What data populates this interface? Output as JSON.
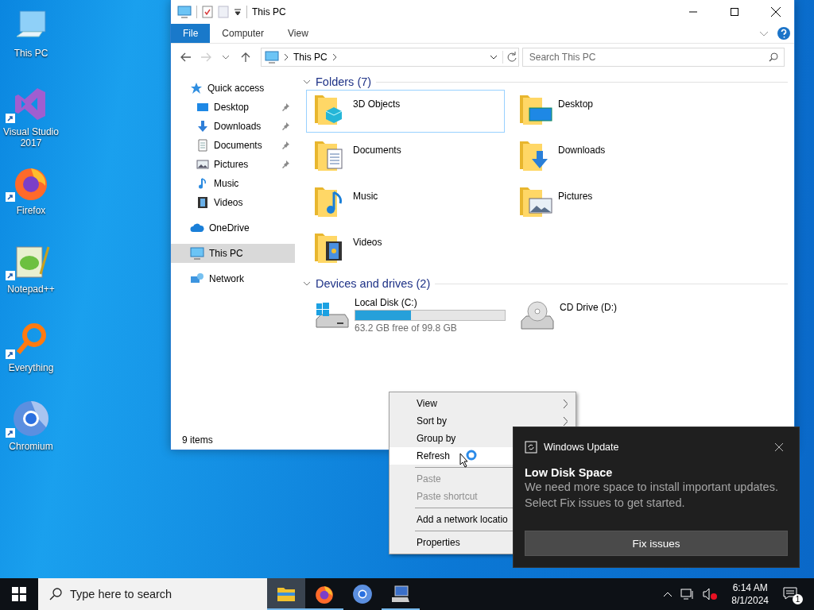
{
  "desktop_icons": [
    {
      "label": "This PC",
      "kind": "pc",
      "shortcut": false
    },
    {
      "label": "Visual Studio 2017",
      "kind": "vs",
      "shortcut": true
    },
    {
      "label": "Firefox",
      "kind": "firefox",
      "shortcut": true
    },
    {
      "label": "Notepad++",
      "kind": "notepad",
      "shortcut": true
    },
    {
      "label": "Everything",
      "kind": "everything",
      "shortcut": true
    },
    {
      "label": "Chromium",
      "kind": "chromium",
      "shortcut": true
    }
  ],
  "explorer": {
    "title": "This PC",
    "ribbon_tabs": [
      {
        "label": "File",
        "selected": true
      },
      {
        "label": "Computer",
        "selected": false
      },
      {
        "label": "View",
        "selected": false
      }
    ],
    "address": {
      "path": "This PC"
    },
    "search": {
      "placeholder": "Search This PC"
    },
    "nav": [
      {
        "label": "Quick access",
        "kind": "star",
        "selected": false,
        "children": [
          {
            "label": "Desktop",
            "kind": "desktop",
            "pinned": true,
            "selected": false
          },
          {
            "label": "Downloads",
            "kind": "downloads",
            "pinned": true,
            "selected": false
          },
          {
            "label": "Documents",
            "kind": "documents",
            "pinned": true,
            "selected": false
          },
          {
            "label": "Pictures",
            "kind": "pictures",
            "pinned": true,
            "selected": false
          },
          {
            "label": "Music",
            "kind": "music",
            "pinned": false,
            "selected": false
          },
          {
            "label": "Videos",
            "kind": "videos",
            "pinned": false,
            "selected": false
          }
        ]
      },
      {
        "label": "OneDrive",
        "kind": "cloud",
        "selected": false
      },
      {
        "label": "This PC",
        "kind": "pc",
        "selected": true
      },
      {
        "label": "Network",
        "kind": "network",
        "selected": false
      }
    ],
    "folders": {
      "heading": "Folders (7)",
      "items": [
        {
          "label": "3D Objects",
          "kind": "objects",
          "selected": true
        },
        {
          "label": "Desktop",
          "kind": "desktop",
          "selected": false
        },
        {
          "label": "Documents",
          "kind": "documents",
          "selected": false
        },
        {
          "label": "Downloads",
          "kind": "downloads",
          "selected": false
        },
        {
          "label": "Music",
          "kind": "music",
          "selected": false
        },
        {
          "label": "Pictures",
          "kind": "pictures",
          "selected": false
        },
        {
          "label": "Videos",
          "kind": "videos",
          "selected": false
        }
      ]
    },
    "drives": {
      "heading": "Devices and drives (2)",
      "items": [
        {
          "label": "Local Disk (C:)",
          "kind": "hdd",
          "level": 0.37,
          "free": "63.2 GB free of 99.8 GB"
        },
        {
          "label": "CD Drive (D:)",
          "kind": "cd"
        }
      ]
    },
    "status_bar": "9 items"
  },
  "context_menu": [
    {
      "kind": "item",
      "label": "View",
      "submenu": true,
      "disabled": false,
      "selected": false
    },
    {
      "kind": "item",
      "label": "Sort by",
      "submenu": true,
      "disabled": false,
      "selected": false
    },
    {
      "kind": "item",
      "label": "Group by",
      "submenu": false,
      "disabled": false,
      "selected": false
    },
    {
      "kind": "item",
      "label": "Refresh",
      "submenu": false,
      "disabled": false,
      "selected": true
    },
    {
      "kind": "separator"
    },
    {
      "kind": "item",
      "label": "Paste",
      "submenu": false,
      "disabled": true,
      "selected": false
    },
    {
      "kind": "item",
      "label": "Paste shortcut",
      "submenu": false,
      "disabled": true,
      "selected": false
    },
    {
      "kind": "separator"
    },
    {
      "kind": "item",
      "label": "Add a network locatio",
      "submenu": false,
      "disabled": false,
      "selected": false
    },
    {
      "kind": "separator"
    },
    {
      "kind": "item",
      "label": "Properties",
      "submenu": false,
      "disabled": false,
      "selected": false
    }
  ],
  "toast": {
    "app": "Windows Update",
    "title": "Low Disk Space",
    "body_lines": [
      "We need more space to install important updates.",
      "Select Fix issues to get started."
    ],
    "button": "Fix issues"
  },
  "taskbar": {
    "search": {
      "placeholder": "Type here to search"
    },
    "apps": [
      {
        "kind": "explorer",
        "running": true,
        "selected": true
      },
      {
        "kind": "firefox",
        "running": true,
        "selected": false
      },
      {
        "kind": "chromium",
        "running": false,
        "selected": false
      },
      {
        "kind": "control",
        "running": true,
        "selected": false
      }
    ],
    "time": "6:14 AM",
    "date": "8/1/2024",
    "notifications": "1"
  }
}
